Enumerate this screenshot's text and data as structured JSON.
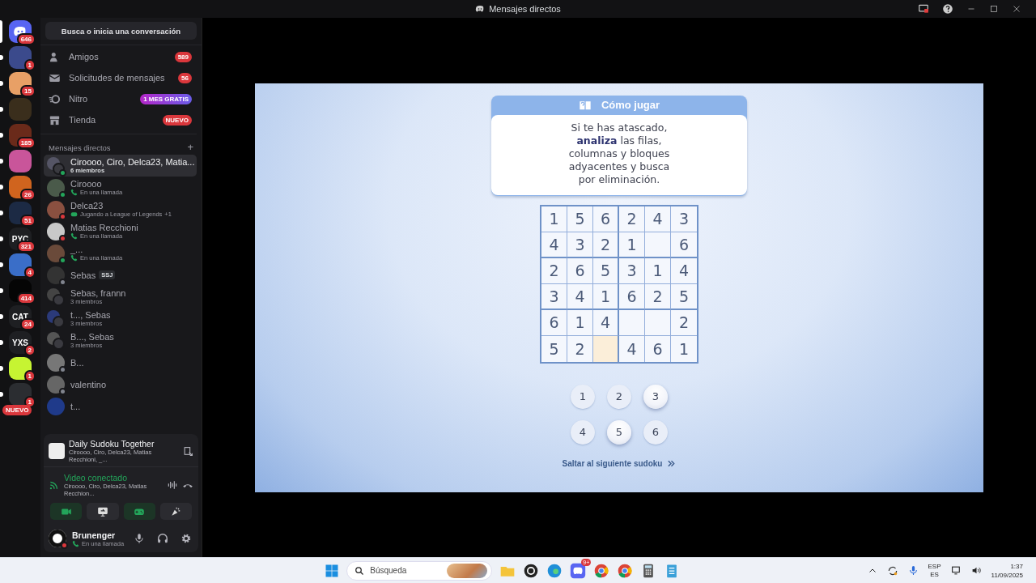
{
  "window": {
    "title": "Mensajes directos"
  },
  "servers": [
    {
      "kind": "home",
      "badge": "646",
      "color": "#5865f2",
      "selected": true
    },
    {
      "kind": "image",
      "badge": "1",
      "color": "#3b4a8c",
      "selected": false,
      "unread": true
    },
    {
      "kind": "image",
      "badge": "15",
      "color": "#e8a066",
      "selected": false,
      "unread": true
    },
    {
      "kind": "image",
      "color": "#3a2e1c",
      "selected": false,
      "unread": true
    },
    {
      "kind": "image",
      "badge": "185",
      "color": "#6a2a1a",
      "selected": false,
      "unread": true
    },
    {
      "kind": "image",
      "color": "#c9559a",
      "selected": false,
      "unread": true
    },
    {
      "kind": "image",
      "badge": "26",
      "color": "#d0641e",
      "selected": false,
      "unread": true
    },
    {
      "kind": "image",
      "badge": "51",
      "color": "#1c2a44",
      "selected": false,
      "unread": true
    },
    {
      "kind": "text",
      "label": "PYC",
      "badge": "321",
      "color": "#1e1f22",
      "selected": false,
      "unread": true
    },
    {
      "kind": "image",
      "badge": "4",
      "color": "#3a6ec8",
      "selected": false,
      "unread": true
    },
    {
      "kind": "image",
      "badge": "414",
      "color": "#050505",
      "selected": false,
      "unread": true
    },
    {
      "kind": "text",
      "label": "CAT",
      "badge": "24",
      "color": "#1e1f22",
      "selected": false,
      "unread": true
    },
    {
      "kind": "text",
      "label": "YXS",
      "badge": "2",
      "color": "#1e1f22",
      "selected": false,
      "unread": true
    },
    {
      "kind": "image",
      "badge": "1",
      "color": "#c6f432",
      "selected": false,
      "unread": true
    },
    {
      "kind": "image",
      "badge": "1",
      "color": "#2b2d31",
      "selected": false,
      "unread": true,
      "new_label": "NUEVO"
    }
  ],
  "search": {
    "label": "Busca o inicia una conversación"
  },
  "nav": [
    {
      "label": "Amigos",
      "badge": "589",
      "kind": "count"
    },
    {
      "label": "Solicitudes de mensajes",
      "badge": "56",
      "kind": "count"
    },
    {
      "label": "Nitro",
      "badge": "1 MES GRATIS",
      "kind": "promo"
    },
    {
      "label": "Tienda",
      "badge": "NUEVO",
      "kind": "count"
    }
  ],
  "dm_header": {
    "label": "Mensajes directos",
    "add": "+"
  },
  "dms": [
    {
      "name": "Ciroooo, Ciro, Delca23, Matia...",
      "subtitle": "6 miembros",
      "kind": "group",
      "color": "#23a55a",
      "selected": true
    },
    {
      "name": "Ciroooo",
      "subtitle": "En una llamada",
      "kind": "call",
      "color": "#23a55a",
      "selected": false
    },
    {
      "name": "Delca23",
      "subtitle": "Jugando a League of Legends",
      "extra": "+1",
      "kind": "game",
      "color": "#da373c",
      "selected": false
    },
    {
      "name": "Matias Recchioni",
      "subtitle": "En una llamada",
      "kind": "call",
      "color": "#da373c",
      "selected": false
    },
    {
      "name": "_...",
      "subtitle": "En una llamada",
      "kind": "call",
      "color": "#23a55a",
      "selected": false
    },
    {
      "name": "Sebas",
      "tag": "SSJ",
      "kind": "person",
      "color": "#80848e",
      "selected": false
    },
    {
      "name": "Sebas, frannn",
      "subtitle": "3 miembros",
      "kind": "group",
      "selected": false
    },
    {
      "name": "t..., Sebas",
      "subtitle": "3 miembros",
      "kind": "group",
      "selected": false
    },
    {
      "name": "B..., Sebas",
      "subtitle": "3 miembros",
      "kind": "group",
      "selected": false
    },
    {
      "name": "B...",
      "kind": "person",
      "color": "#80848e",
      "selected": false
    },
    {
      "name": "valentino",
      "kind": "person",
      "color": "#80848e",
      "selected": false
    },
    {
      "name": "t...",
      "kind": "person",
      "selected": false
    }
  ],
  "activity": {
    "title": "Daily Sudoku Together",
    "participants": "Ciroooo, Ciro, Delca23, Matias Recchioni, _..."
  },
  "voice": {
    "status": "Video conectado",
    "participants": "Ciroooo, Ciro, Delca23, Matias Recchion..."
  },
  "voice_buttons": [
    {
      "kind": "camera",
      "active": true
    },
    {
      "kind": "screen",
      "active": false
    },
    {
      "kind": "gamepad",
      "active": true
    },
    {
      "kind": "sparkle",
      "active": false
    }
  ],
  "user": {
    "name": "Brunenger",
    "status_text": "En una llamada",
    "color": "#da373c"
  },
  "game": {
    "how_to_play": {
      "title": "Cómo jugar",
      "text": "Si te has atascado,\n**analiza** las filas,\ncolumnas y bloques\nadyacentes y busca\npor eliminación."
    },
    "grid": [
      [
        {
          "value": "1",
          "selected": false
        },
        {
          "value": "5",
          "selected": false
        },
        {
          "value": "6",
          "selected": false
        },
        {
          "value": "2",
          "selected": false
        },
        {
          "value": "4",
          "selected": false
        },
        {
          "value": "3",
          "selected": false
        }
      ],
      [
        {
          "value": "4",
          "selected": false
        },
        {
          "value": "3",
          "selected": false
        },
        {
          "value": "2",
          "selected": false
        },
        {
          "value": "1",
          "selected": false
        },
        {
          "selected": false
        },
        {
          "value": "6",
          "selected": false
        }
      ],
      [
        {
          "value": "2",
          "selected": false
        },
        {
          "value": "6",
          "selected": false
        },
        {
          "value": "5",
          "selected": false
        },
        {
          "value": "3",
          "selected": false
        },
        {
          "value": "1",
          "selected": false
        },
        {
          "value": "4",
          "selected": false
        }
      ],
      [
        {
          "value": "3",
          "selected": false
        },
        {
          "value": "4",
          "selected": false
        },
        {
          "value": "1",
          "selected": false
        },
        {
          "value": "6",
          "selected": false
        },
        {
          "value": "2",
          "selected": false
        },
        {
          "value": "5",
          "selected": false
        }
      ],
      [
        {
          "value": "6",
          "selected": false
        },
        {
          "value": "1",
          "selected": false
        },
        {
          "value": "4",
          "selected": false
        },
        {
          "selected": false
        },
        {
          "selected": false
        },
        {
          "value": "2",
          "selected": false
        }
      ],
      [
        {
          "value": "5",
          "selected": false
        },
        {
          "value": "2",
          "selected": false
        },
        {
          "selected": true
        },
        {
          "value": "4",
          "selected": false
        },
        {
          "value": "6",
          "selected": false
        },
        {
          "value": "1",
          "selected": false
        }
      ]
    ],
    "number_pad": [
      {
        "label": "1",
        "raised": false
      },
      {
        "label": "2",
        "raised": false
      },
      {
        "label": "3",
        "raised": true
      },
      {
        "label": "4",
        "raised": false
      },
      {
        "label": "5",
        "raised": true
      },
      {
        "label": "6",
        "raised": false
      }
    ],
    "skip_link": "Saltar al siguiente sudoku"
  },
  "taskbar": {
    "search_placeholder": "Búsqueda",
    "apps": [
      {
        "kind": "folder"
      },
      {
        "kind": "obs"
      },
      {
        "kind": "edge"
      },
      {
        "kind": "discord",
        "badge": "9+"
      },
      {
        "kind": "chrome"
      },
      {
        "kind": "chrome"
      },
      {
        "kind": "calculator"
      },
      {
        "kind": "notepad"
      }
    ],
    "language": "ESP",
    "layout": "ES",
    "time": "1:37",
    "date": "11/09/2025"
  }
}
